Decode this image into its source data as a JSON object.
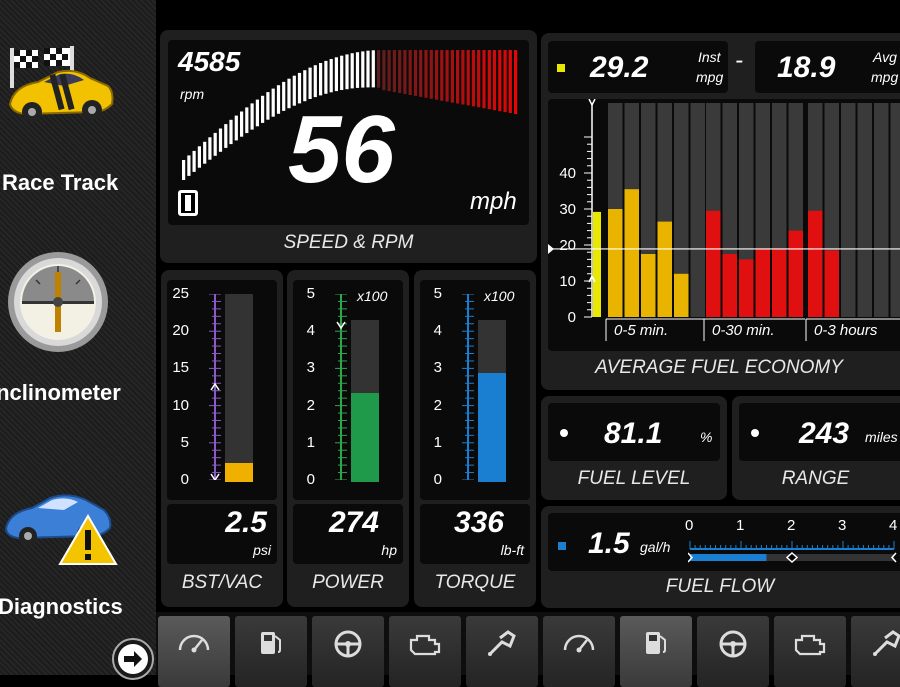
{
  "sidebar": {
    "items": [
      {
        "label": "Race Track",
        "icon": "race-car-icon"
      },
      {
        "label": "Inclinometer",
        "icon": "inclinometer-icon"
      },
      {
        "label": "Diagnostics",
        "icon": "diagnostics-car-icon"
      }
    ]
  },
  "speed": {
    "rpm_value": "4585",
    "rpm_unit": "rpm",
    "speed_value": "56",
    "speed_unit": "mph",
    "gear_label": "0",
    "caption": "SPEED & RPM",
    "rpm_fill_fraction": 0.76
  },
  "boost": {
    "scale": [
      "25",
      "20",
      "15",
      "10",
      "5",
      "0"
    ],
    "value": "2.5",
    "unit": "psi",
    "caption": "BST/VAC",
    "bar_color": "#f0b000",
    "fill_fraction": 0.1
  },
  "power": {
    "scale": [
      "5",
      "4",
      "3",
      "2",
      "1",
      "0"
    ],
    "multiplier": "x100",
    "value": "274",
    "unit": "hp",
    "caption": "POWER",
    "bar_color": "#1f9a4a",
    "fill_fraction": 0.55
  },
  "torque": {
    "scale": [
      "5",
      "4",
      "3",
      "2",
      "1",
      "0"
    ],
    "multiplier": "x100",
    "value": "336",
    "unit": "lb-ft",
    "caption": "TORQUE",
    "bar_color": "#1a7fd0",
    "fill_fraction": 0.67
  },
  "mpg": {
    "inst_value": "29.2",
    "inst_label_1": "Inst",
    "inst_label_2": "mpg",
    "separator": "-",
    "avg_value": "18.9",
    "avg_label_1": "Avg",
    "avg_label_2": "mpg"
  },
  "fuel_economy": {
    "caption": "AVERAGE FUEL ECONOMY",
    "y_ticks": [
      "40",
      "30",
      "20",
      "10",
      "0"
    ],
    "colors": {
      "yellow": "#e8b400",
      "red": "#e01010"
    },
    "chart_data": {
      "type": "bar",
      "ylim": [
        0,
        50
      ],
      "groups": [
        {
          "label": "0-5 min.",
          "values": [
            30,
            35.5,
            17.5,
            26.5,
            12
          ]
        },
        {
          "label": "0-30 min.",
          "values": [
            29.5,
            17.5,
            16,
            19,
            19,
            24
          ]
        },
        {
          "label": "0-3 hours",
          "values": [
            29.5,
            18.5
          ]
        }
      ],
      "current_value": 29.2,
      "average_value": 18.9
    }
  },
  "fuel_level": {
    "value": "81.1",
    "unit": "%",
    "caption": "FUEL LEVEL"
  },
  "range": {
    "value": "243",
    "unit": "miles",
    "caption": "RANGE"
  },
  "fuel_flow": {
    "value": "1.5",
    "unit": "gal/h",
    "caption": "FUEL FLOW",
    "scale": [
      "0",
      "1",
      "2",
      "3",
      "4"
    ],
    "fill_fraction": 0.375,
    "marker_fraction": 0.5
  },
  "tabs": [
    {
      "icon": "speedometer-icon",
      "active": true
    },
    {
      "icon": "fuel-pump-icon",
      "active": false
    },
    {
      "icon": "steering-wheel-icon",
      "active": false
    },
    {
      "icon": "engine-icon",
      "active": false
    },
    {
      "icon": "fuel-nozzle-icon",
      "active": false
    },
    {
      "icon": "speedometer-icon",
      "active": false
    },
    {
      "icon": "fuel-pump-icon",
      "active": true
    },
    {
      "icon": "steering-wheel-icon",
      "active": false
    },
    {
      "icon": "engine-icon",
      "active": false
    },
    {
      "icon": "fuel-nozzle-icon",
      "active": false
    }
  ]
}
